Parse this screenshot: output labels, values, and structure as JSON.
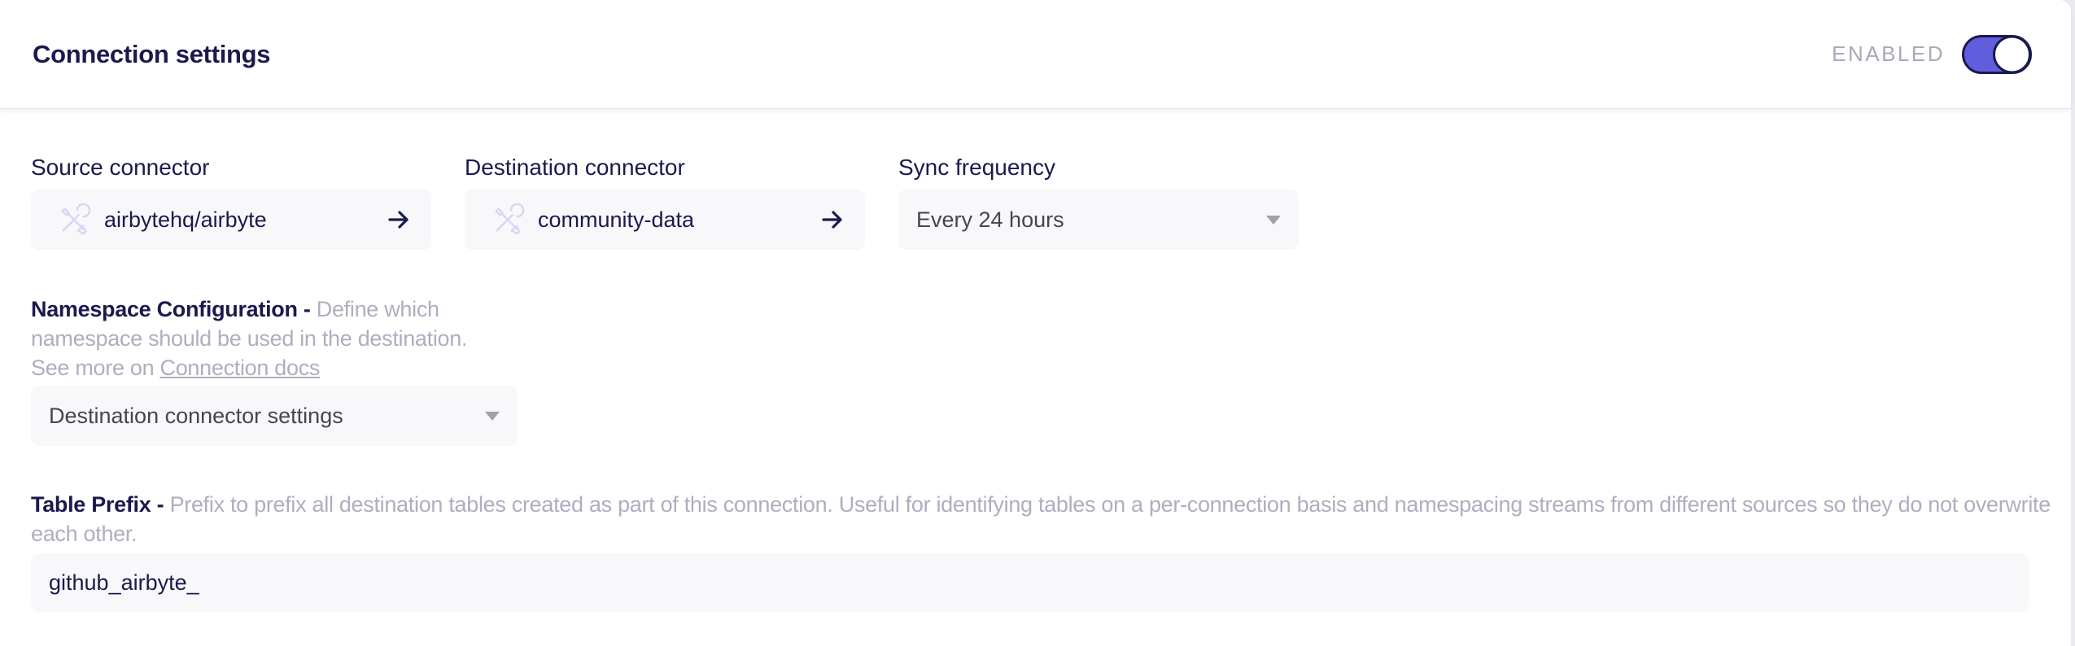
{
  "header": {
    "title": "Connection settings",
    "status_label": "ENABLED",
    "toggle_state": "on"
  },
  "fields": {
    "source": {
      "label": "Source connector",
      "value": "airbytehq/airbyte"
    },
    "destination": {
      "label": "Destination connector",
      "value": "community-data"
    },
    "sync_frequency": {
      "label": "Sync frequency",
      "value": "Every 24 hours"
    }
  },
  "namespace": {
    "title": "Namespace Configuration -",
    "description": "Define which namespace should be used in the destination. See more on",
    "link_text": "Connection docs",
    "selected_option": "Destination connector settings"
  },
  "table_prefix": {
    "title": "Table Prefix -",
    "description": "Prefix to prefix all destination tables created as part of this connection. Useful for identifying tables on a per-connection basis and namespacing streams from different sources so they do not overwrite each other.",
    "value": "github_airbyte_"
  },
  "colors": {
    "accent_purple": "#615ede",
    "navy_text": "#191a4d",
    "muted_text": "#aeaec0",
    "field_background": "#f8f8fa",
    "icon_lavender": "#d7d7f3"
  },
  "icons": {
    "source_card_icon": "tools-icon",
    "destination_card_icon": "tools-icon",
    "card_action_icon": "arrow-right-icon",
    "dropdown_icon": "chevron-down-icon"
  }
}
